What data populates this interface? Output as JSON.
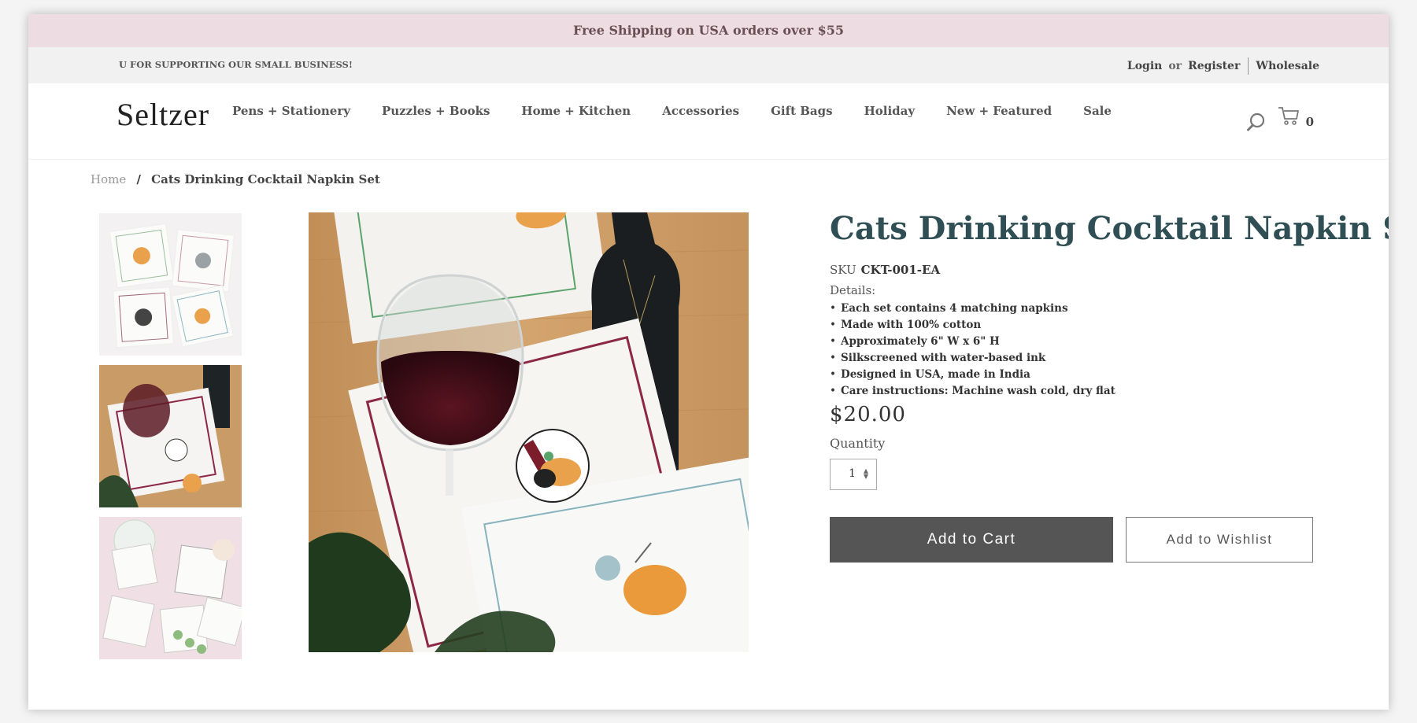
{
  "promo": {
    "text": "Free Shipping on USA orders over $55"
  },
  "topbar": {
    "tagline": "U FOR SUPPORTING OUR SMALL BUSINESS!",
    "login": "Login",
    "or": "or",
    "register": "Register",
    "wholesale": "Wholesale"
  },
  "header": {
    "logo": "Seltzer",
    "nav": [
      "Pens + Stationery",
      "Puzzles + Books",
      "Home + Kitchen",
      "Accessories",
      "Gift Bags",
      "Holiday",
      "New + Featured",
      "Sale"
    ],
    "cart_count": "0",
    "icons": {
      "search": "search-icon",
      "cart": "cart-icon"
    }
  },
  "breadcrumb": {
    "home": "Home",
    "separator": "/",
    "current": "Cats Drinking Cocktail Napkin Set"
  },
  "product": {
    "title": "Cats Drinking Cocktail Napkin Set",
    "sku_label": "SKU",
    "sku": "CKT-001-EA",
    "details_label": "Details:",
    "details": [
      "Each set contains 4 matching napkins",
      "Made with 100% cotton",
      "Approximately 6\" W x 6\" H",
      "Silkscreened with water-based ink",
      "Designed in USA, made in India",
      "Care instructions: Machine wash cold, dry flat"
    ],
    "price": "$20.00",
    "quantity_label": "Quantity",
    "quantity": "1",
    "add_to_cart": "Add to Cart",
    "add_to_wishlist": "Add to Wishlist"
  },
  "colors": {
    "promo_bg": "#eddde2",
    "title": "#2f4f55",
    "cart_button": "#555555"
  }
}
